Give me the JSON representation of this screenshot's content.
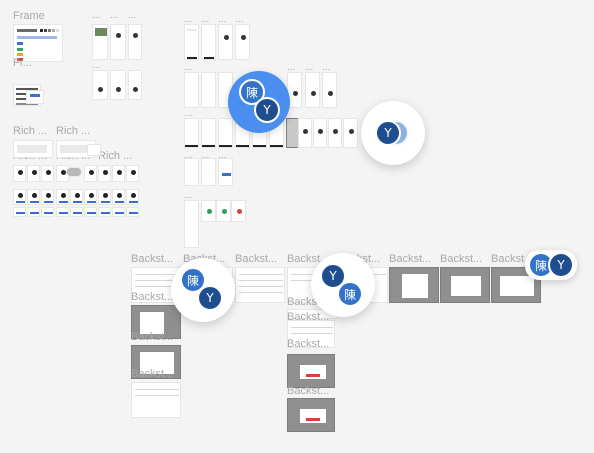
{
  "labels": {
    "frame": "Frame",
    "frame_short": "Fr...",
    "rich_1": "Rich ...",
    "rich_2": "Rich ...",
    "rich_3": "Rich ...",
    "rich_4": "Rich ...",
    "rich_5": "Rich ...",
    "ellipsis": "...",
    "backstage": "Backst..."
  },
  "avatars": {
    "chen": "陳",
    "y": "Y"
  },
  "colors": {
    "canvas": "#f4f4f4",
    "avatar_dark": "#1f4e8f",
    "avatar_mid": "#3273c9",
    "cursor_blue": "#4a8ff0"
  }
}
